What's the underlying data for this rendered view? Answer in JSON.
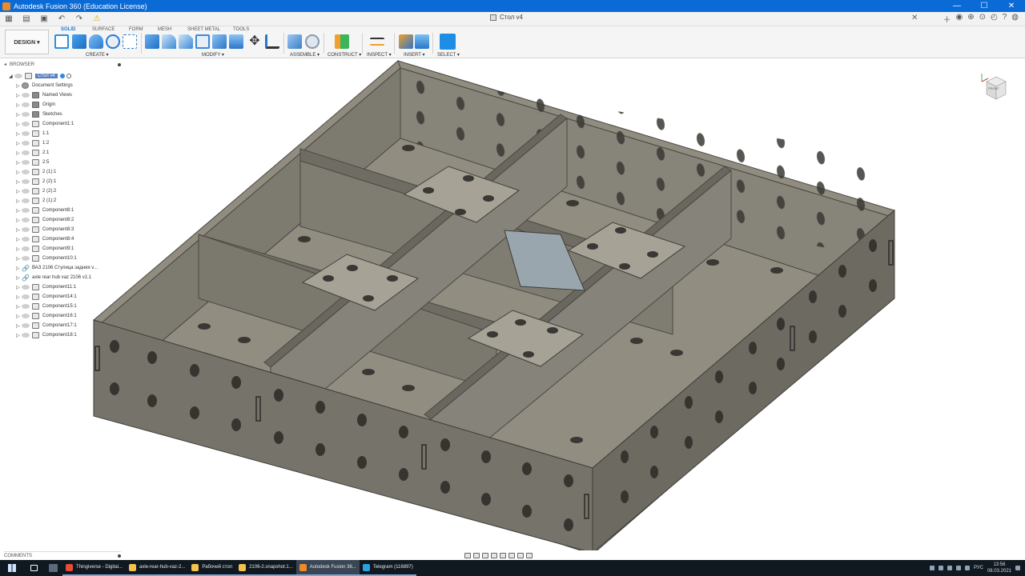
{
  "window": {
    "title": "Autodesk Fusion 360 (Education License)",
    "minimize": "—",
    "maximize": "☐",
    "close": "✕"
  },
  "document": {
    "tab_title": "Стол v4"
  },
  "ribbon": {
    "workspace": "DESIGN ▾",
    "tabs": [
      "SOLID",
      "SURFACE",
      "FORM",
      "MESH",
      "SHEET METAL",
      "TOOLS"
    ],
    "groups": [
      "CREATE ▾",
      "MODIFY ▾",
      "ASSEMBLE ▾",
      "CONSTRUCT ▾",
      "INSPECT ▾",
      "INSERT ▾",
      "SELECT ▾"
    ]
  },
  "browser": {
    "header": "BROWSER",
    "root": "Стол v4",
    "items": [
      {
        "label": "Document Settings",
        "icon": "gear"
      },
      {
        "label": "Named Views",
        "icon": "folder"
      },
      {
        "label": "Origin",
        "icon": "folder"
      },
      {
        "label": "Sketches",
        "icon": "folder"
      },
      {
        "label": "Component1:1",
        "icon": "component"
      },
      {
        "label": "1:1",
        "icon": "component"
      },
      {
        "label": "1:2",
        "icon": "component"
      },
      {
        "label": "2:1",
        "icon": "component"
      },
      {
        "label": "2:5",
        "icon": "component"
      },
      {
        "label": "2 (1):1",
        "icon": "component"
      },
      {
        "label": "2 (2):1",
        "icon": "component"
      },
      {
        "label": "2 (2):2",
        "icon": "component"
      },
      {
        "label": "2 (1):2",
        "icon": "component"
      },
      {
        "label": "Component8:1",
        "icon": "component"
      },
      {
        "label": "Component8:2",
        "icon": "component"
      },
      {
        "label": "Component8:3",
        "icon": "component"
      },
      {
        "label": "Component8:4",
        "icon": "component"
      },
      {
        "label": "Component9:1",
        "icon": "component"
      },
      {
        "label": "Component10:1",
        "icon": "component"
      },
      {
        "label": "ВАЗ 2106 Ступица задняя v...",
        "icon": "link"
      },
      {
        "label": "axle rear hub vaz 2106 v1:1",
        "icon": "link"
      },
      {
        "label": "Component11:1",
        "icon": "component"
      },
      {
        "label": "Component14:1",
        "icon": "component"
      },
      {
        "label": "Component15:1",
        "icon": "component"
      },
      {
        "label": "Component16:1",
        "icon": "component"
      },
      {
        "label": "Component17:1",
        "icon": "component"
      },
      {
        "label": "Component18:1",
        "icon": "component"
      }
    ]
  },
  "viewcube": {
    "face": "FRONT"
  },
  "comments": {
    "header": "COMMENTS"
  },
  "taskbar": {
    "tasks": [
      {
        "label": "Thingiverse - Digital...",
        "color": "#e84a3c",
        "active": false
      },
      {
        "label": "axle-rear-hub-vaz-2...",
        "color": "#f2c14e",
        "active": false
      },
      {
        "label": "Рабочий стол",
        "color": "#f2c14e",
        "active": false
      },
      {
        "label": "2106-2.snapshot.1...",
        "color": "#f2c14e",
        "active": false
      },
      {
        "label": "Autodesk Fusion 36...",
        "color": "#f08a24",
        "active": true
      },
      {
        "label": "Telegram (116897)",
        "color": "#2aa3e0",
        "active": false
      }
    ],
    "language": "РУС",
    "time": "13:56",
    "date": "08.03.2021"
  },
  "colors": {
    "titlebar": "#0b6bd6",
    "model_top": "#8e8a7e",
    "model_side": "#77736a",
    "model_dark": "#5e5b54"
  }
}
